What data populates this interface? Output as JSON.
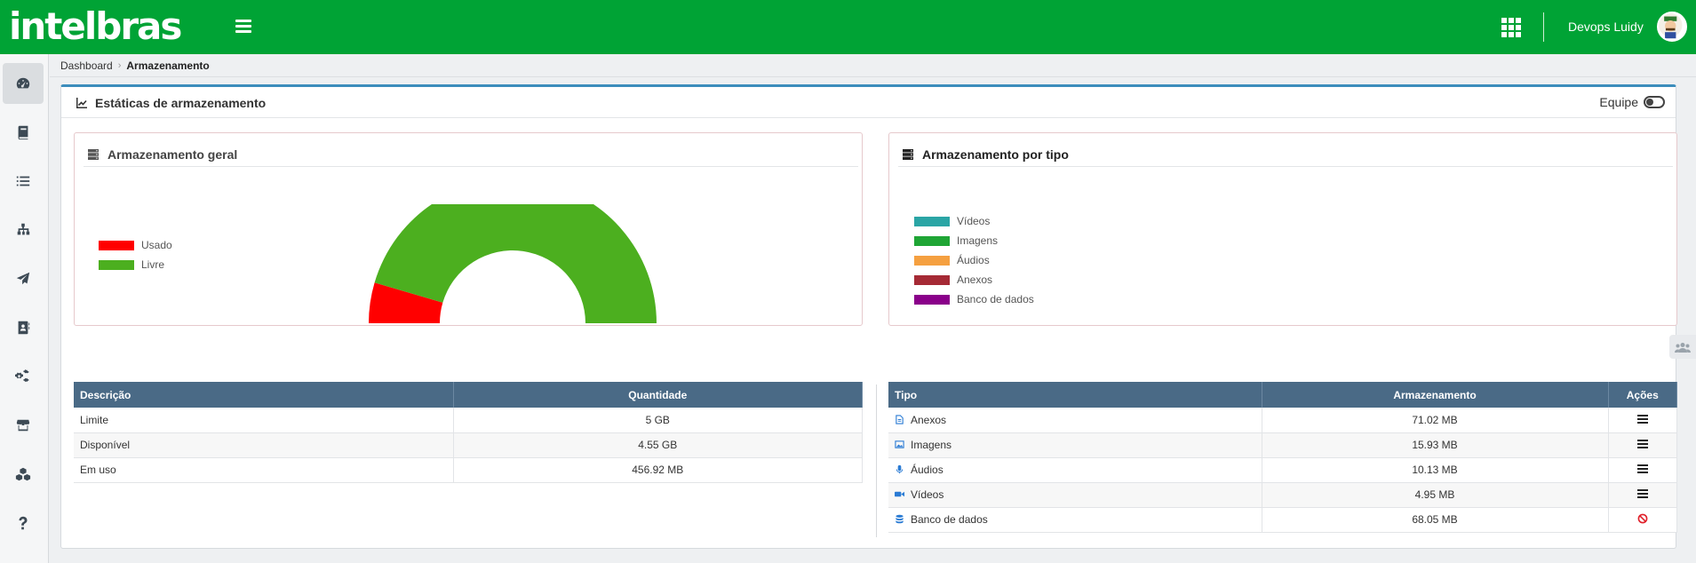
{
  "brand": {
    "logo_text": "intelbras",
    "primary_color": "#00a335"
  },
  "header": {
    "user_name": "Devops Luidy",
    "apps_icon": "grid-icon",
    "menu_icon": "hamburger-icon"
  },
  "sidebar": {
    "items": [
      {
        "icon": "dashboard-icon",
        "active": true
      },
      {
        "icon": "book-icon"
      },
      {
        "icon": "list-icon"
      },
      {
        "icon": "sitemap-icon"
      },
      {
        "icon": "paper-plane-icon"
      },
      {
        "icon": "address-book-icon"
      },
      {
        "icon": "cogs-icon"
      },
      {
        "icon": "store-icon"
      },
      {
        "icon": "cubes-icon"
      },
      {
        "icon": "help-icon"
      }
    ]
  },
  "breadcrumb": {
    "root": "Dashboard",
    "current": "Armazenamento"
  },
  "panel": {
    "title": "Estáticas de armazenamento",
    "team_label": "Equipe"
  },
  "general": {
    "title": "Armazenamento geral",
    "legend": [
      {
        "label": "Usado",
        "color": "#ff0000"
      },
      {
        "label": "Livre",
        "color": "#4caf1f"
      }
    ],
    "table": {
      "headers": [
        "Descrição",
        "Quantidade"
      ],
      "rows": [
        [
          "Limite",
          "5 GB"
        ],
        [
          "Disponível",
          "4.55 GB"
        ],
        [
          "Em uso",
          "456.92 MB"
        ]
      ]
    }
  },
  "by_type": {
    "title": "Armazenamento por tipo",
    "legend": [
      {
        "label": "Vídeos",
        "color": "#2aa5a5"
      },
      {
        "label": "Imagens",
        "color": "#1fa535"
      },
      {
        "label": "Áudios",
        "color": "#f5a040"
      },
      {
        "label": "Anexos",
        "color": "#a52a35"
      },
      {
        "label": "Banco de dados",
        "color": "#8a008a"
      }
    ],
    "table": {
      "headers": [
        "Tipo",
        "Armazenamento",
        "Ações"
      ],
      "rows": [
        {
          "tipo": "Anexos",
          "icon": "file-icon",
          "valor": "71.02 MB",
          "acao": "menu-icon"
        },
        {
          "tipo": "Imagens",
          "icon": "image-icon",
          "valor": "15.93 MB",
          "acao": "menu-icon"
        },
        {
          "tipo": "Áudios",
          "icon": "microphone-icon",
          "valor": "10.13 MB",
          "acao": "menu-icon"
        },
        {
          "tipo": "Vídeos",
          "icon": "video-icon",
          "valor": "4.95 MB",
          "acao": "menu-icon"
        },
        {
          "tipo": "Banco de dados",
          "icon": "database-icon",
          "valor": "68.05 MB",
          "acao": "ban-icon"
        }
      ]
    }
  },
  "chart_data": {
    "type": "pie",
    "half_donut": true,
    "categories": [
      "Usado",
      "Livre"
    ],
    "values": [
      0.45692,
      4.55
    ],
    "colors": [
      "#ff0000",
      "#4caf1f"
    ]
  }
}
